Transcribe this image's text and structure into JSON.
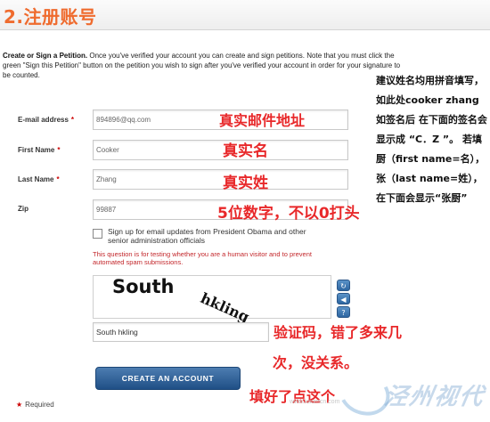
{
  "header": {
    "title": "2.注册账号"
  },
  "intro": {
    "bold": "Create or Sign a Petition.",
    "text": " Once you've verified your account you can create and sign petitions. Note that you must click the green \"Sign this Petition\" button on the petition you wish to sign after you've verified your account in order for your signature to be counted."
  },
  "side_note": "建议姓名均用拼音填写，如此处cooker zhang 如签名后 在下面的签名会显示成 “C．Z ”。 若填 厨（first name=名），张（last name=姓），在下面会显示“张厨”",
  "form": {
    "email": {
      "label": "E-mail address",
      "value": "894896@qq.com",
      "annotation": "真实邮件地址"
    },
    "first_name": {
      "label": "First Name",
      "value": "Cooker",
      "annotation": "真实名"
    },
    "last_name": {
      "label": "Last Name",
      "value": "Zhang",
      "annotation": "真实姓"
    },
    "zip": {
      "label": "Zip",
      "value": "99887",
      "annotation": "5位数字，不以0打头"
    },
    "required_star": "*"
  },
  "signup": {
    "label": "Sign up for email updates from President Obama and other senior administration officials",
    "checked": false
  },
  "captcha": {
    "note": "This question is for testing whether you are a human visitor and to prevent automated spam submissions.",
    "word1": "South",
    "word2": "hkling",
    "answer": "South hkling",
    "annotation_line1": "验证码，错了多来几",
    "annotation_line2": "次，没关系。",
    "buttons": [
      "refresh-icon",
      "audio-icon",
      "help-icon"
    ]
  },
  "create_button": {
    "label": "CREATE AN ACCOUNT",
    "annotation": "填好了点这个"
  },
  "required_note": "Required",
  "watermark": {
    "text": "泾州视代",
    "url": "www.kaumcn.com"
  },
  "colors": {
    "header_title": "#ef6b2e",
    "annotation": "#e8282a",
    "button": "#2a5a93"
  }
}
